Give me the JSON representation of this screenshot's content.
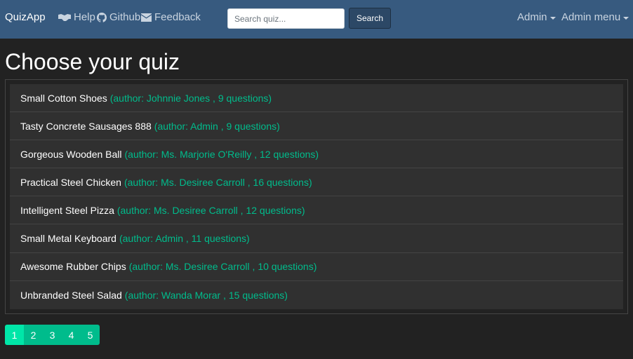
{
  "navbar": {
    "brand": "QuizApp",
    "links": [
      {
        "label": "Help",
        "icon": "handshake-icon"
      },
      {
        "label": "Github",
        "icon": "github-icon"
      },
      {
        "label": "Feedback",
        "icon": "envelope-icon"
      }
    ],
    "search_placeholder": "Search quiz...",
    "search_button": "Search",
    "admin_label": "Admin",
    "admin_menu_label": "Admin menu"
  },
  "page": {
    "title": "Choose your quiz"
  },
  "quizzes": [
    {
      "name": "Small Cotton Shoes",
      "meta": "(author: Johnnie Jones , 9 questions)"
    },
    {
      "name": "Tasty Concrete Sausages 888",
      "meta": "(author: Admin , 9 questions)"
    },
    {
      "name": "Gorgeous Wooden Ball",
      "meta": "(author: Ms. Marjorie O'Reilly , 12 questions)"
    },
    {
      "name": "Practical Steel Chicken",
      "meta": "(author: Ms. Desiree Carroll , 16 questions)"
    },
    {
      "name": "Intelligent Steel Pizza",
      "meta": "(author: Ms. Desiree Carroll , 12 questions)"
    },
    {
      "name": "Small Metal Keyboard",
      "meta": "(author: Admin , 11 questions)"
    },
    {
      "name": "Awesome Rubber Chips",
      "meta": "(author: Ms. Desiree Carroll , 10 questions)"
    },
    {
      "name": "Unbranded Steel Salad",
      "meta": "(author: Wanda Morar , 15 questions)"
    }
  ],
  "pagination": {
    "pages": [
      "1",
      "2",
      "3",
      "4",
      "5"
    ],
    "active": "1"
  },
  "colors": {
    "navbar": "#375a7f",
    "background": "#222222",
    "accent": "#00bc8c",
    "list_item": "#303030"
  }
}
